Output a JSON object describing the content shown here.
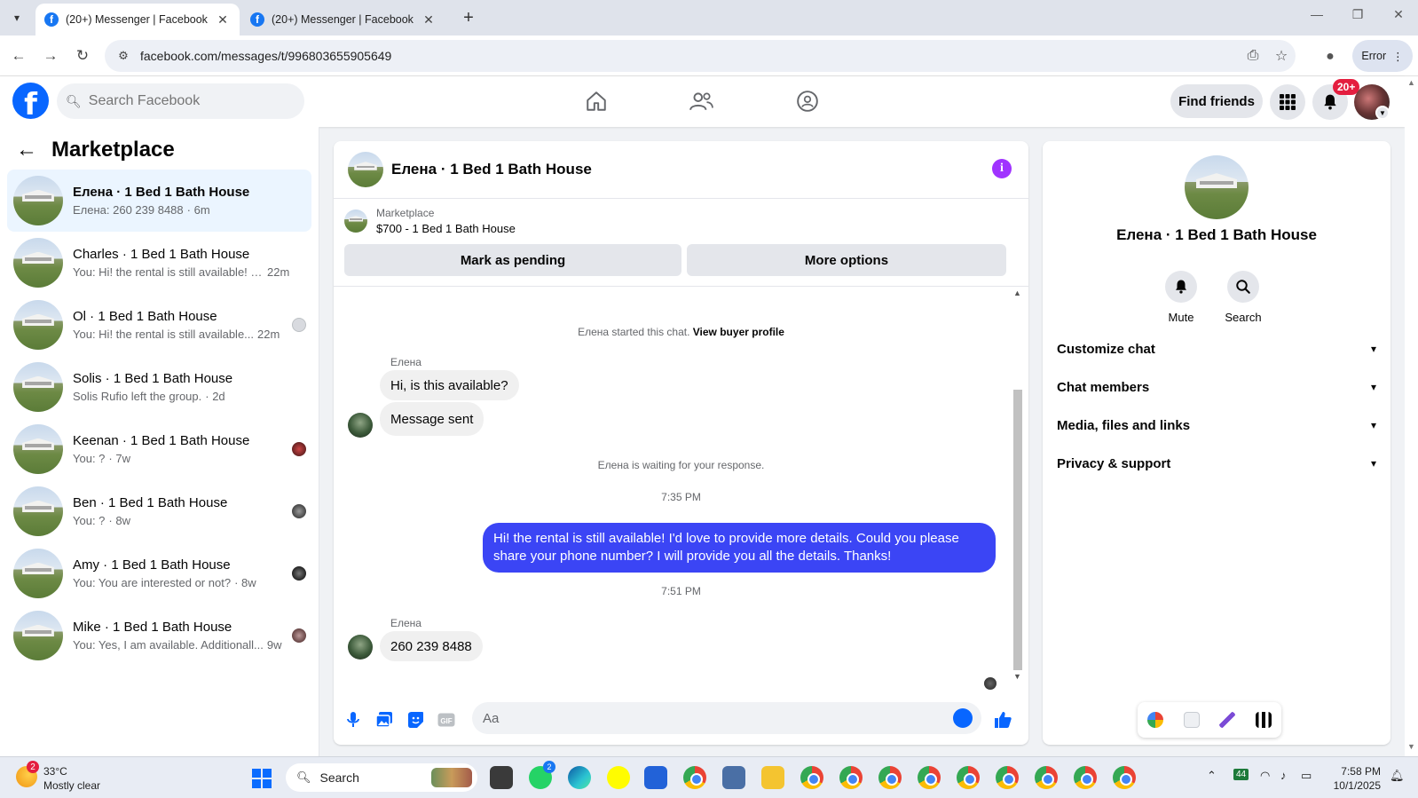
{
  "browser": {
    "tabs": [
      {
        "title": "(20+) Messenger | Facebook",
        "active": true
      },
      {
        "title": "(20+) Messenger | Facebook",
        "active": false
      }
    ],
    "url": "facebook.com/messages/t/996803655905649",
    "error_label": "Error"
  },
  "fbnav": {
    "logo": "f",
    "search_placeholder": "Search Facebook",
    "find_friends": "Find friends",
    "notif_count": "20+"
  },
  "left": {
    "title": "Marketplace",
    "conversations": [
      {
        "name": "Елена · 1 Bed 1 Bath House",
        "snippet": "Елена: 260 239 8488",
        "time": "· 6m",
        "active": true
      },
      {
        "name": "Charles · 1 Bed 1 Bath House",
        "snippet": "You: Hi! the rental is still available! I'...",
        "time": "22m"
      },
      {
        "name": "Ol · 1 Bed 1 Bath House",
        "snippet": "You: Hi! the rental is still available...",
        "time": "22m"
      },
      {
        "name": "Solis · 1 Bed 1 Bath House",
        "snippet": "Solis Rufio left the group.",
        "time": "· 2d"
      },
      {
        "name": "Keenan · 1 Bed 1 Bath House",
        "snippet": "You: ?",
        "time": "· 7w"
      },
      {
        "name": "Ben · 1 Bed 1 Bath House",
        "snippet": "You: ?",
        "time": "· 8w"
      },
      {
        "name": "Amy · 1 Bed 1 Bath House",
        "snippet": "You: You are interested or not?",
        "time": "· 8w"
      },
      {
        "name": "Mike · 1 Bed 1 Bath House",
        "snippet": "You: Yes, I am available. Additionall...",
        "time": "9w"
      }
    ]
  },
  "chat": {
    "title": "Елена · 1 Bed 1 Bath House",
    "marketplace_label": "Marketplace",
    "listing": "$700 - 1 Bed 1 Bath House",
    "mark_pending": "Mark as pending",
    "more_options": "More options",
    "started_text": "Елена started this chat.",
    "view_profile": "View buyer profile",
    "sender": "Елена",
    "msg1": "Hi, is this available?",
    "msg2": "Message sent",
    "waiting_text": "Елена is waiting for your response.",
    "time1": "7:35 PM",
    "outgoing": "Hi! the rental is still available! I'd love to provide more details. Could you please share your phone number? I will provide you all the details. Thanks!",
    "time2": "7:51 PM",
    "msg3": "260 239 8488",
    "composer_placeholder": "Aa"
  },
  "right": {
    "name": "Елена · 1 Bed 1 Bath House",
    "mute": "Mute",
    "search": "Search",
    "items": [
      "Customize chat",
      "Chat members",
      "Media, files and links",
      "Privacy & support"
    ]
  },
  "taskbar": {
    "weather_badge": "2",
    "temp": "33°C",
    "condition": "Mostly clear",
    "search": "Search",
    "whatsapp_badge": "2",
    "tray_badge": "44",
    "time": "7:58 PM",
    "date": "10/1/2025"
  },
  "colors": {
    "fb_blue": "#0866ff",
    "outgoing_bubble": "#3b45f5",
    "info_purple": "#a033ff",
    "active_conv_bg": "#ebf5ff"
  }
}
